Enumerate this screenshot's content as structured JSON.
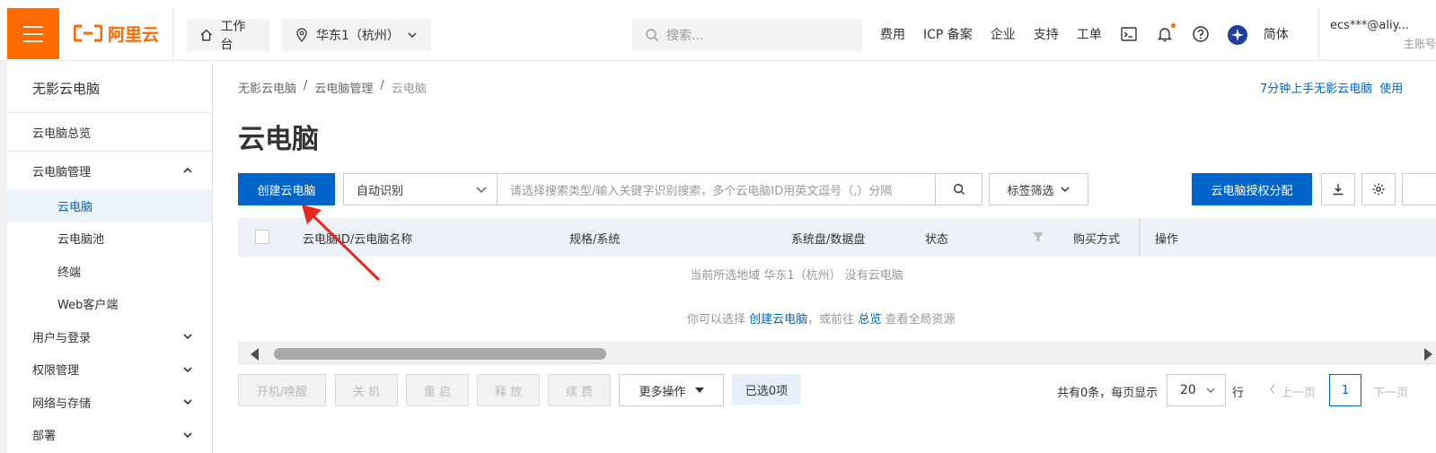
{
  "topbar": {
    "logo_text": "阿里云",
    "workbench": "工作台",
    "region": "华东1（杭州）",
    "search_placeholder": "搜索...",
    "links": [
      "费用",
      "ICP 备案",
      "企业",
      "支持",
      "工单"
    ],
    "lang": "简体",
    "user": "ecs***@aliy...",
    "user_sub": "主账号"
  },
  "sidebar": {
    "title": "无影云电脑",
    "items": [
      {
        "label": "云电脑总览"
      },
      {
        "label": "云电脑管理"
      },
      {
        "label": "云电脑"
      },
      {
        "label": "云电脑池"
      },
      {
        "label": "终端"
      },
      {
        "label": "Web客户端"
      },
      {
        "label": "用户与登录"
      },
      {
        "label": "权限管理"
      },
      {
        "label": "网络与存储"
      },
      {
        "label": "部署"
      }
    ]
  },
  "breadcrumb": [
    "无影云电脑",
    "/",
    "云电脑管理",
    "/",
    "云电脑"
  ],
  "guide_link": "7分钟上手无影云电脑",
  "guide_link2": "使用",
  "page_title": "云电脑",
  "toolbar": {
    "create_label": "创建云电脑",
    "search_type": "自动识别",
    "keyword_placeholder": "请选择搜索类型/输入关键字识别搜索，多个云电脑ID用英文逗号（,）分隔",
    "tag_filter": "标签筛选",
    "auth_label": "云电脑授权分配"
  },
  "table": {
    "columns": [
      "云电脑ID/云电脑名称",
      "规格/系统",
      "系统盘/数据盘",
      "状态",
      "购买方式",
      "操作"
    ],
    "empty_text": "当前所选地域 华东1（杭州） 没有云电脑",
    "empty_hint_prefix": "你可以选择",
    "empty_hint_link1": "创建云电脑",
    "empty_hint_mid": "，或前往",
    "empty_hint_link2": "总览",
    "empty_hint_suffix": "查看全局资源"
  },
  "actions": {
    "start": "开机/唤醒",
    "shutdown": "关 机",
    "restart": "重 启",
    "release": "释 放",
    "renew": "续 费",
    "more": "更多操作",
    "selected": "已选0项"
  },
  "pagination": {
    "total_text": "共有0条，每页显示",
    "page_size": "20",
    "unit": "行",
    "prev": "上一页",
    "current": "1",
    "next": "下一页"
  },
  "colors": {
    "brand_orange": "#ff6a00",
    "primary_blue": "#0064c8",
    "annotation_red": "#e8281e"
  }
}
